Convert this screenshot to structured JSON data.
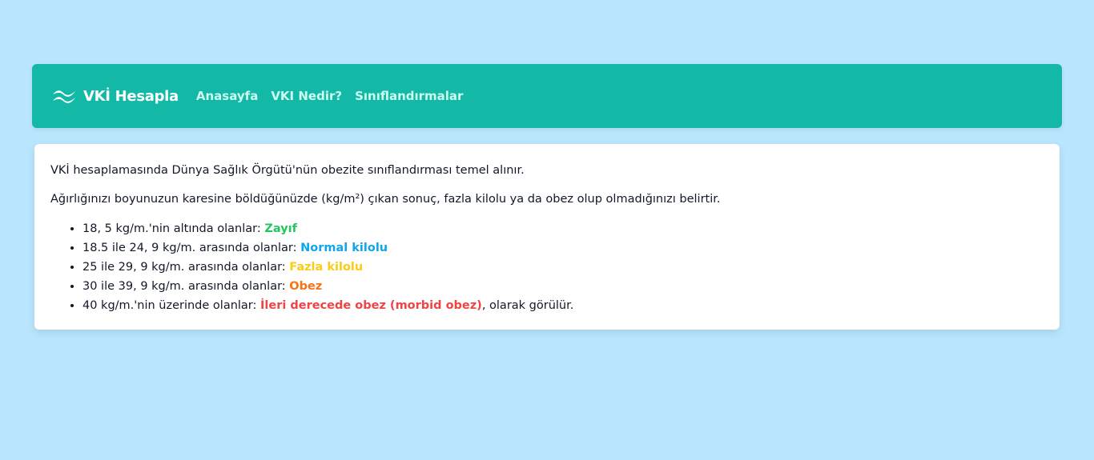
{
  "colors": {
    "background": "#bae6fd",
    "navbar": "#14b8a6",
    "nav_link": "#ccfbf1",
    "zayif": "#22c55e",
    "normal": "#0ea5e9",
    "fazla": "#facc15",
    "obez": "#f97316",
    "morbid": "#ef4444"
  },
  "navbar": {
    "brand_icon": "tailwind-wave-icon",
    "brand": "VKİ Hesapla",
    "links": [
      {
        "label": "Anasayfa"
      },
      {
        "label": "VKI Nedir?"
      },
      {
        "label": "Sınıflandırmalar"
      }
    ]
  },
  "content": {
    "intro": "VKİ hesaplamasında Dünya Sağlık Örgütü'nün obezite sınıflandırması temel alınır.",
    "explanation": "Ağırlığınızı boyunuzun karesine böldüğünüzde (kg/m²) çıkan sonuç, fazla kilolu ya da obez olup olmadığınızı belirtir.",
    "items": [
      {
        "prefix": "18, 5 kg/m.'nin altında olanlar: ",
        "label": "Zayıf",
        "suffix": ""
      },
      {
        "prefix": "18.5 ile 24, 9 kg/m. arasında olanlar: ",
        "label": "Normal kilolu",
        "suffix": ""
      },
      {
        "prefix": "25 ile 29, 9 kg/m. arasında olanlar: ",
        "label": "Fazla kilolu",
        "suffix": ""
      },
      {
        "prefix": "30 ile 39, 9 kg/m. arasında olanlar: ",
        "label": "Obez",
        "suffix": ""
      },
      {
        "prefix": "40 kg/m.'nin üzerinde olanlar: ",
        "label": "İleri derecede obez (morbid obez)",
        "suffix": ", olarak görülür."
      }
    ]
  }
}
